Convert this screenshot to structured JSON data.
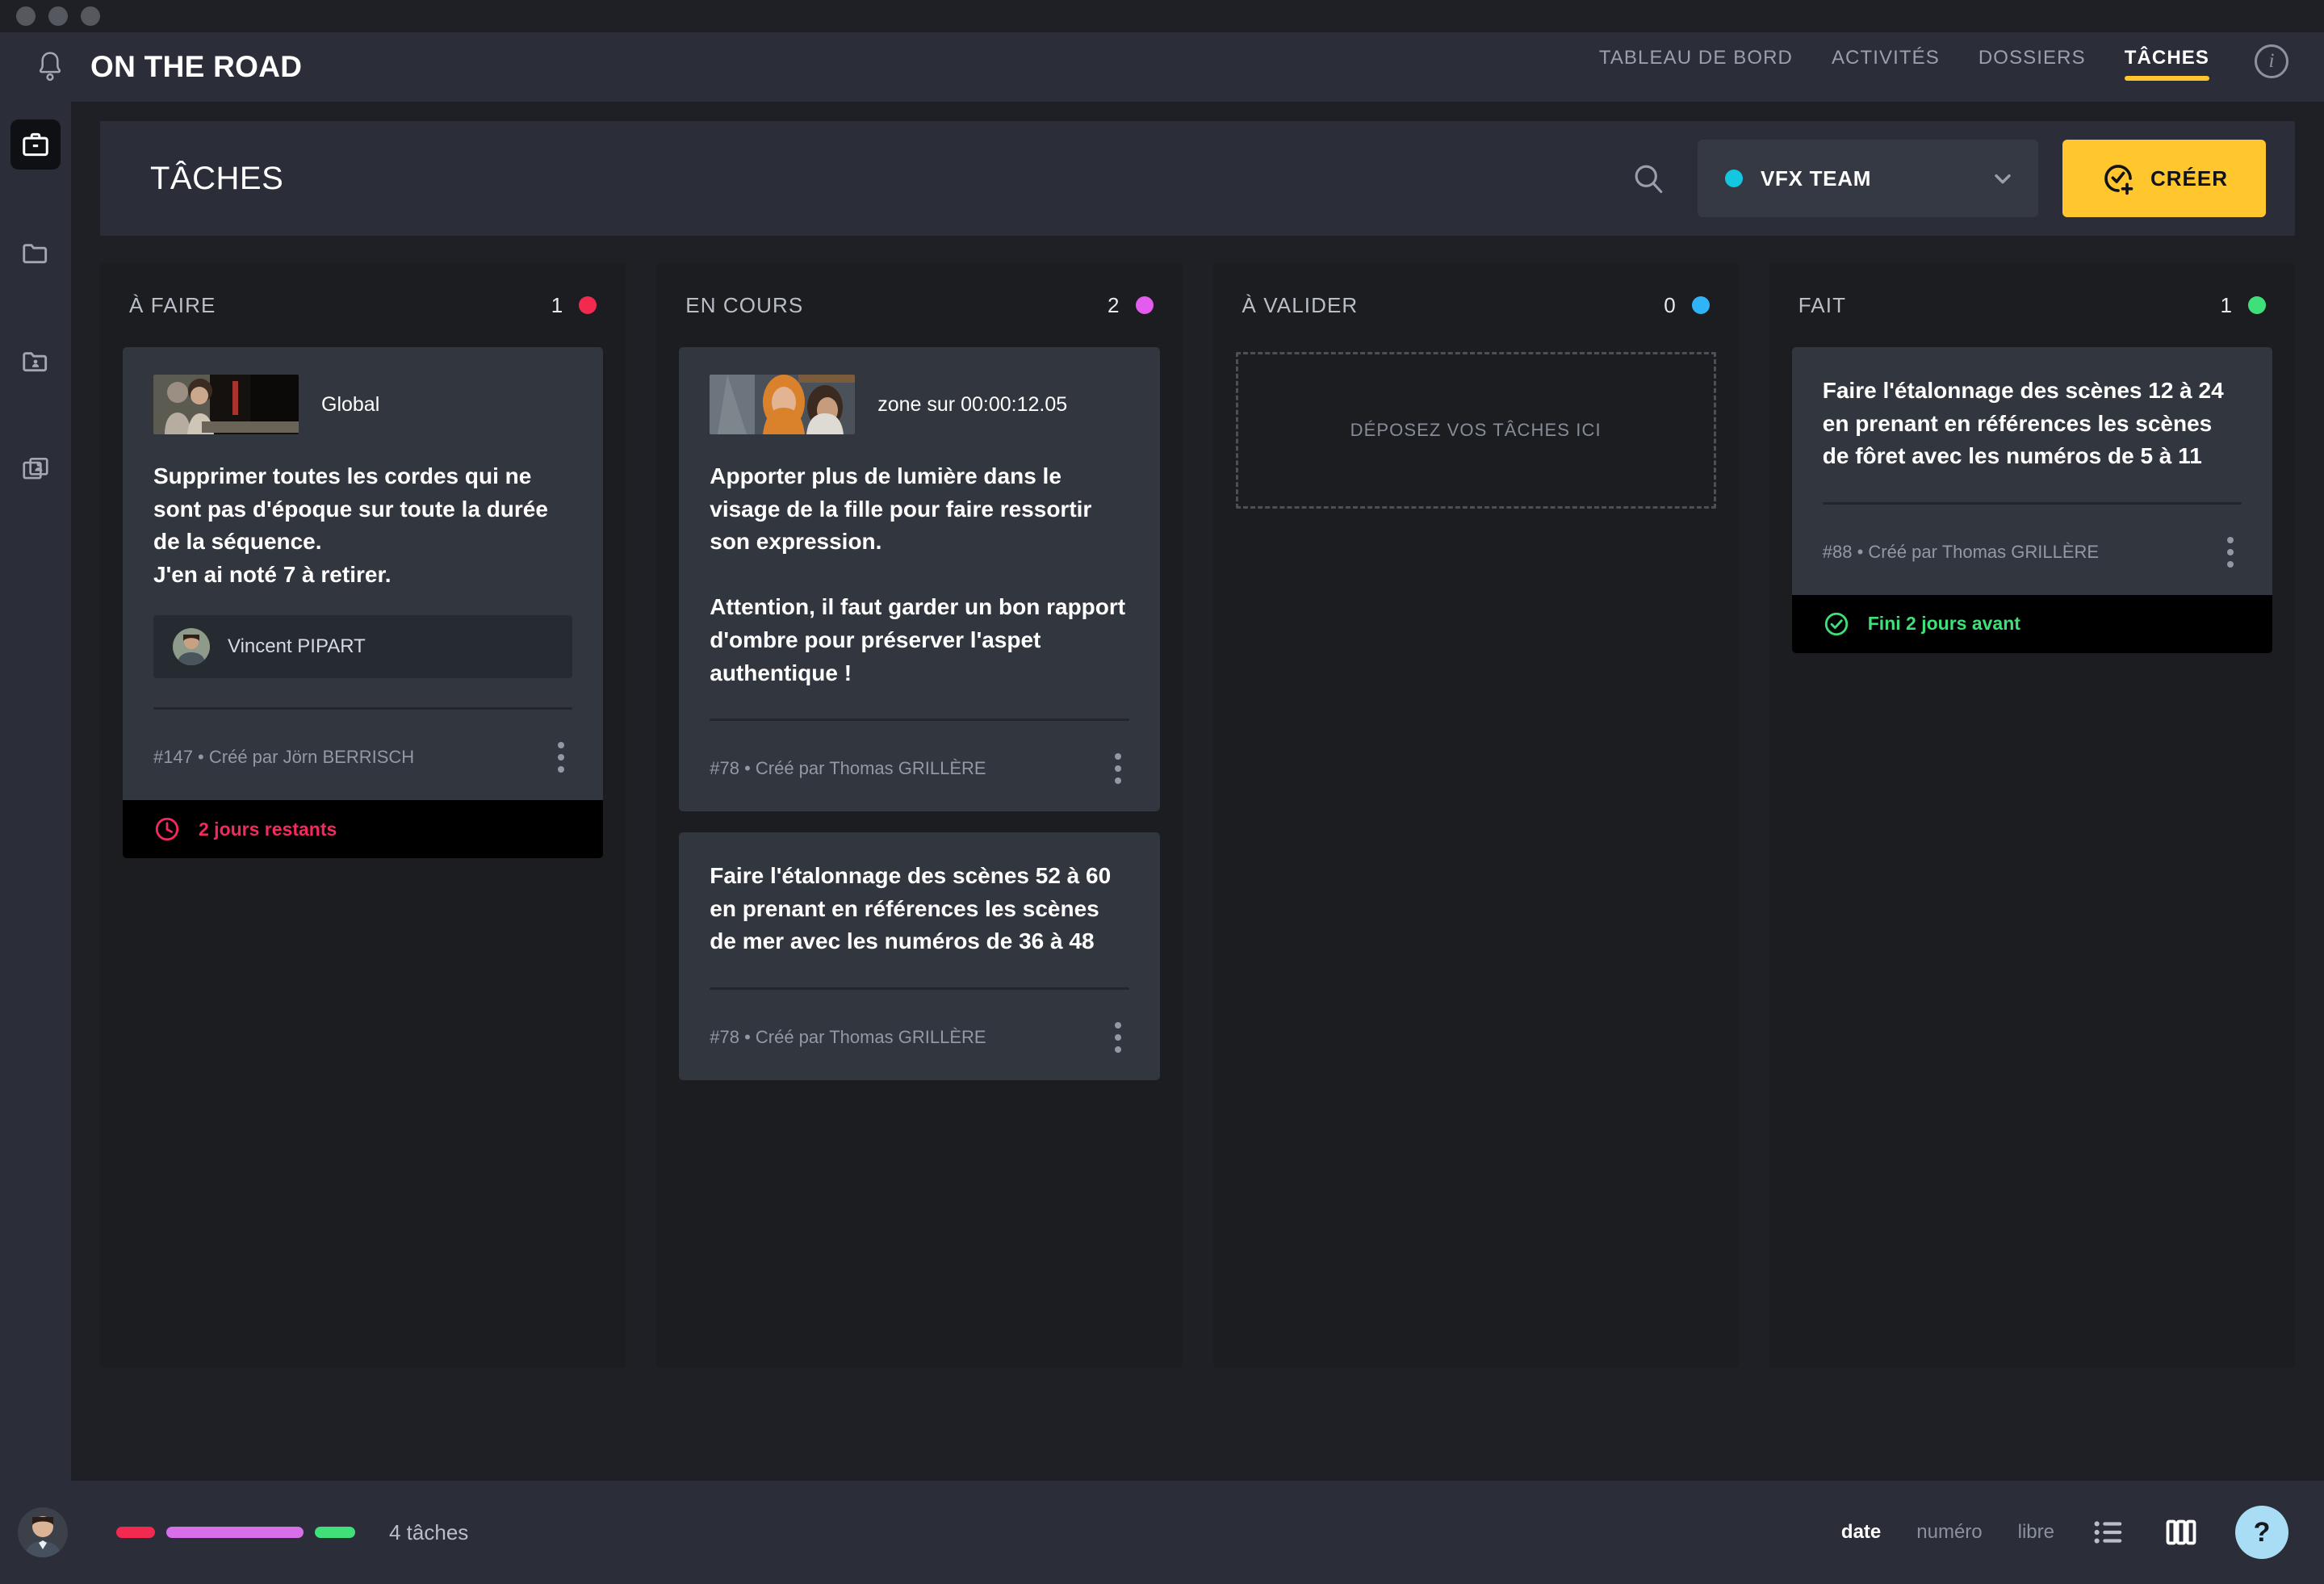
{
  "window": {
    "traffic_lights": [
      "close",
      "minimize",
      "maximize"
    ]
  },
  "topnav": {
    "bell_icon": "bell-icon",
    "brand": "ON THE ROAD",
    "items": [
      {
        "label": "TABLEAU DE BORD",
        "active": false
      },
      {
        "label": "ACTIVITÉS",
        "active": false
      },
      {
        "label": "DOSSIERS",
        "active": false
      },
      {
        "label": "TÂCHES",
        "active": true
      }
    ],
    "info_icon": "info-icon",
    "active_underline_color": "#ffc62e"
  },
  "rail": {
    "items": [
      {
        "icon": "briefcase-icon",
        "name": "sidebar-item-tasks",
        "active": true
      },
      {
        "icon": "folder-icon",
        "name": "sidebar-item-folders",
        "active": false
      },
      {
        "icon": "folder-person-icon",
        "name": "sidebar-item-shared-folders",
        "active": false
      },
      {
        "icon": "media-person-icon",
        "name": "sidebar-item-media",
        "active": false
      }
    ]
  },
  "toolbar": {
    "page_title": "TÂCHES",
    "search_icon": "search-icon",
    "team": {
      "label": "VFX TEAM",
      "dot_color": "#13c7e0",
      "chevron_icon": "chevron-down-icon"
    },
    "create": {
      "label": "CRÉER",
      "icon": "add-task-icon",
      "bg_color": "#ffc62e"
    }
  },
  "board": {
    "columns": [
      {
        "title": "À FAIRE",
        "count": "1",
        "dot_color": "#f4294f",
        "dropzone": null,
        "cards": [
          {
            "thumb": "shot-thumbnail",
            "thumb_label": "Global",
            "text": "Supprimer toutes les cordes qui ne sont pas d'époque sur toute la durée de la séquence.\nJ'en ai noté 7 à retirer.",
            "assignee": "Vincent PIPART",
            "meta": "#147  •  Créé par Jörn BERRISCH",
            "footer": {
              "icon": "clock-icon",
              "text": "2 jours restants",
              "color": "#f4295c"
            }
          }
        ]
      },
      {
        "title": "EN COURS",
        "count": "2",
        "dot_color": "#e45ced",
        "dropzone": null,
        "cards": [
          {
            "thumb": "shot-thumbnail",
            "thumb_label": "zone sur 00:00:12.05",
            "text": "Apporter plus de lumière dans le visage de la fille pour faire ressortir son expression.\n\nAttention, il faut garder un bon rapport d'ombre pour préserver l'aspet authentique !",
            "assignee": null,
            "meta": "#78  •  Créé par Thomas GRILLÈRE",
            "footer": null
          },
          {
            "thumb": null,
            "thumb_label": null,
            "text": "Faire l'étalonnage des scènes 52 à 60 en prenant en références les scènes de mer avec les numéros de 36 à 48",
            "assignee": null,
            "meta": "#78  •  Créé par Thomas GRILLÈRE",
            "footer": null
          }
        ]
      },
      {
        "title": "À VALIDER",
        "count": "0",
        "dot_color": "#2fb4f7",
        "dropzone": "DÉPOSEZ VOS TÂCHES ICI",
        "cards": []
      },
      {
        "title": "FAIT",
        "count": "1",
        "dot_color": "#3fe07a",
        "dropzone": null,
        "cards": [
          {
            "thumb": null,
            "thumb_label": null,
            "text": "Faire l'étalonnage des scènes 12 à 24 en prenant en références les scènes de fôret avec les numéros de 5 à 11",
            "assignee": null,
            "meta": "#88  •  Créé par Thomas GRILLÈRE",
            "footer": {
              "icon": "check-circle-icon",
              "text": "Fini 2 jours avant",
              "color": "#3fe07a"
            }
          }
        ]
      }
    ]
  },
  "bottombar": {
    "avatar": "user-avatar",
    "progress": [
      {
        "color": "#f4294f",
        "width": 48
      },
      {
        "color": "#d66fe8",
        "width": 170
      },
      {
        "color": "#3fe07a",
        "width": 50
      }
    ],
    "task_count": "4 tâches",
    "sorts": [
      {
        "label": "date",
        "active": true
      },
      {
        "label": "numéro",
        "active": false
      },
      {
        "label": "libre",
        "active": false
      }
    ],
    "views": [
      {
        "icon": "list-view-icon",
        "name": "view-list-button"
      },
      {
        "icon": "column-view-icon",
        "name": "view-columns-button"
      }
    ],
    "help": {
      "label": "?",
      "bg_color": "#a8ddf5"
    }
  }
}
